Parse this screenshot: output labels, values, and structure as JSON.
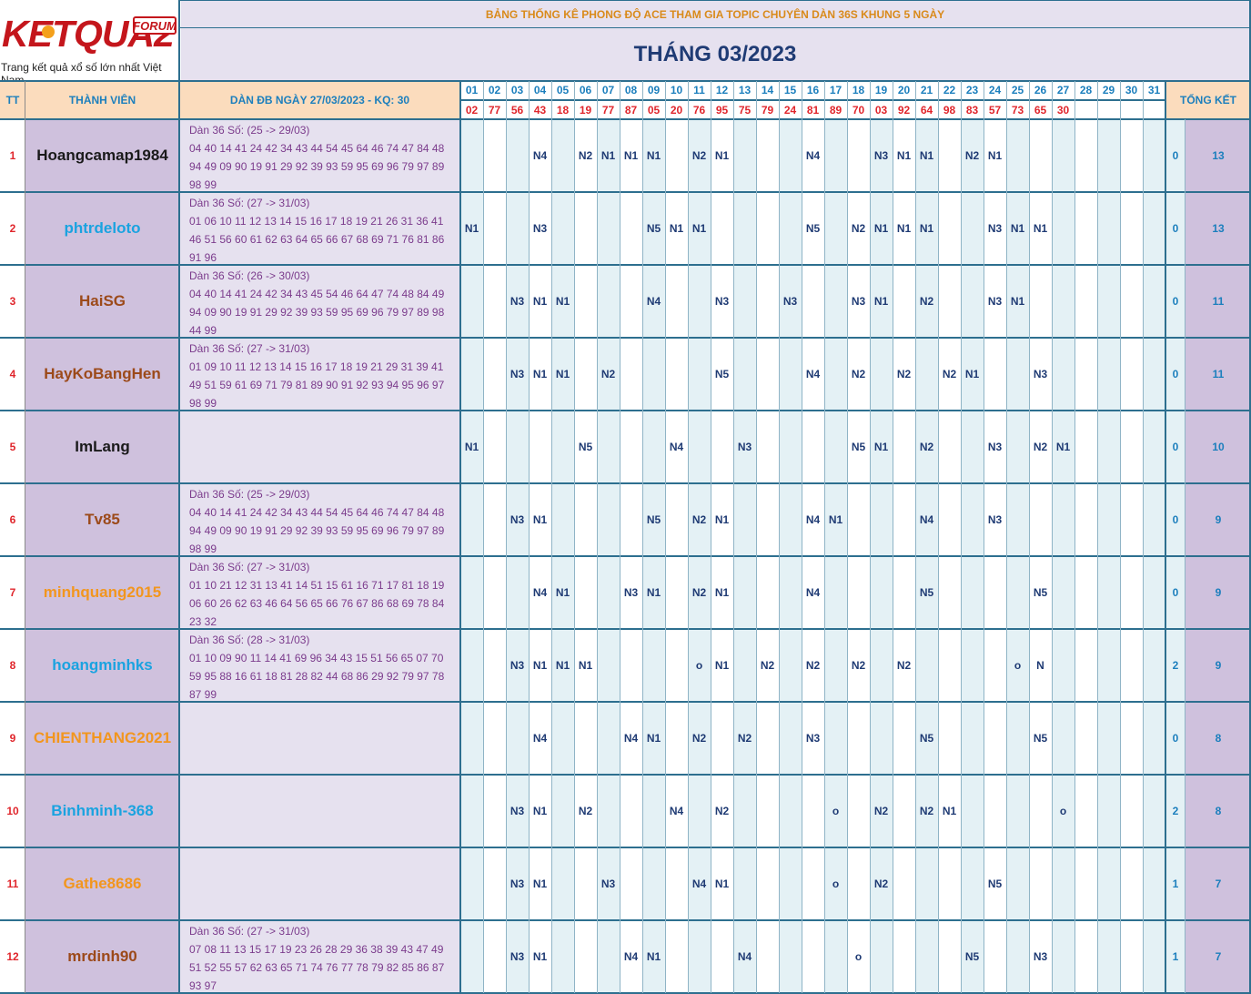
{
  "logo": {
    "word": "KETQUA2",
    "badge": "FORUM",
    "tagline": "Trang kết quả xổ số lớn nhất Việt Nam"
  },
  "header": {
    "title": "BẢNG THỐNG KÊ PHONG ĐỘ ACE THAM GIA TOPIC CHUYÊN DÀN 36S KHUNG 5 NGÀY",
    "month": "THÁNG 03/2023",
    "col_tt": "TT",
    "col_member": "THÀNH VIÊN",
    "col_dan": "DÀN ĐB NGÀY 27/03/2023 - KQ: 30",
    "col_total": "TỔNG KẾT"
  },
  "days": [
    "01",
    "02",
    "03",
    "04",
    "05",
    "06",
    "07",
    "08",
    "09",
    "10",
    "11",
    "12",
    "13",
    "14",
    "15",
    "16",
    "17",
    "18",
    "19",
    "20",
    "21",
    "22",
    "23",
    "24",
    "25",
    "26",
    "27",
    "28",
    "29",
    "30",
    "31"
  ],
  "results": [
    "02",
    "77",
    "56",
    "43",
    "18",
    "19",
    "77",
    "87",
    "05",
    "20",
    "76",
    "95",
    "75",
    "79",
    "24",
    "81",
    "89",
    "70",
    "03",
    "92",
    "64",
    "98",
    "83",
    "57",
    "73",
    "65",
    "30",
    "",
    "",
    "",
    ""
  ],
  "colors": {
    "member_bg": "#cfc1dd",
    "dan_bg": "#e6e1ef",
    "grid_a": "#e4f1f5",
    "grid_b": "#ffffff",
    "header_peach": "#fbdcbd",
    "header_lavender": "#e6e1ef",
    "border": "#2d6f8f",
    "total_b_bg": "#cfc1dd"
  },
  "rows": [
    {
      "tt": "1",
      "name": "Hoangcamap1984",
      "color": "#1a1a1a",
      "dan": [
        "Dàn 36 Số: (25 -> 29/03)",
        "04 40 14 41 24 42 34 43 44 54 45 64 46 74 47 84 48",
        "94 49 09 90 19 91 29 92 39 93 59 95 69 96 79 97 89",
        "98 99"
      ],
      "marks": {
        "4": "N4",
        "6": "N2",
        "7": "N1",
        "8": "N1",
        "9": "N1",
        "11": "N2",
        "12": "N1",
        "16": "N4",
        "19": "N3",
        "20": "N1",
        "21": "N1",
        "23": "N2",
        "24": "N1"
      },
      "total_a": "0",
      "total_b": "13"
    },
    {
      "tt": "2",
      "name": "phtrdeloto",
      "color": "#1aa3e0",
      "dan": [
        "Dàn 36 Số: (27 -> 31/03)",
        "01 06 10 11 12 13 14 15 16 17 18 19 21 26 31 36 41",
        "46 51 56 60 61 62 63 64 65 66 67 68 69 71 76 81 86",
        "91 96"
      ],
      "marks": {
        "1": "N1",
        "4": "N3",
        "9": "N5",
        "10": "N1",
        "11": "N1",
        "16": "N5",
        "18": "N2",
        "19": "N1",
        "20": "N1",
        "21": "N1",
        "24": "N3",
        "25": "N1",
        "26": "N1"
      },
      "total_a": "0",
      "total_b": "13"
    },
    {
      "tt": "3",
      "name": "HaiSG",
      "color": "#9c4a1a",
      "dan": [
        "Dàn 36 Số: (26 -> 30/03)",
        "04 40 14 41 24 42 34 43 45 54 46 64 47 74 48 84 49",
        "94 09 90 19 91 29 92 39 93 59 95 69 96 79 97 89 98",
        "44 99"
      ],
      "marks": {
        "3": "N3",
        "4": "N1",
        "5": "N1",
        "9": "N4",
        "12": "N3",
        "15": "N3",
        "18": "N3",
        "19": "N1",
        "21": "N2",
        "24": "N3",
        "25": "N1"
      },
      "total_a": "0",
      "total_b": "11"
    },
    {
      "tt": "4",
      "name": "HayKoBangHen",
      "color": "#9c4a1a",
      "dan": [
        "Dàn 36 Số: (27 -> 31/03)",
        "01 09 10 11 12 13 14 15 16 17 18 19 21 29 31 39 41",
        "49 51 59 61 69 71 79 81 89 90 91 92 93 94 95 96 97",
        "98 99"
      ],
      "marks": {
        "3": "N3",
        "4": "N1",
        "5": "N1",
        "7": "N2",
        "12": "N5",
        "16": "N4",
        "18": "N2",
        "20": "N2",
        "22": "N2",
        "23": "N1",
        "26": "N3"
      },
      "total_a": "0",
      "total_b": "11"
    },
    {
      "tt": "5",
      "name": "ImLang",
      "color": "#1a1a1a",
      "dan": [],
      "marks": {
        "1": "N1",
        "6": "N5",
        "10": "N4",
        "13": "N3",
        "18": "N5",
        "19": "N1",
        "21": "N2",
        "24": "N3",
        "26": "N2",
        "27": "N1"
      },
      "total_a": "0",
      "total_b": "10"
    },
    {
      "tt": "6",
      "name": "Tv85",
      "color": "#9c4a1a",
      "dan": [
        "Dàn 36 Số: (25 -> 29/03)",
        "04 40 14 41 24 42 34 43 44 54 45 64 46 74 47 84 48",
        "94 49 09 90 19 91 29 92 39 93 59 95 69 96 79 97 89",
        "98 99"
      ],
      "marks": {
        "3": "N3",
        "4": "N1",
        "9": "N5",
        "11": "N2",
        "12": "N1",
        "16": "N4",
        "17": "N1",
        "21": "N4",
        "24": "N3"
      },
      "total_a": "0",
      "total_b": "9"
    },
    {
      "tt": "7",
      "name": "minhquang2015",
      "color": "#f2961e",
      "dan": [
        "Dàn 36 Số: (27 -> 31/03)",
        "01 10 21 12 31 13 41 14 51 15 61 16 71 17 81 18 19",
        "06 60 26 62 63 46 64 56 65 66 76 67 86 68 69 78 84",
        "23 32"
      ],
      "marks": {
        "4": "N4",
        "5": "N1",
        "8": "N3",
        "9": "N1",
        "11": "N2",
        "12": "N1",
        "16": "N4",
        "21": "N5",
        "26": "N5"
      },
      "total_a": "0",
      "total_b": "9"
    },
    {
      "tt": "8",
      "name": "hoangminhks",
      "color": "#1aa3e0",
      "dan": [
        "Dàn 36 Số: (28 -> 31/03)",
        "01 10 09 90 11 14 41 69 96 34 43 15 51 56 65 07 70",
        "59 95 88 16 61 18 81 28 82 44 68 86 29 92 79 97 78",
        "87 99"
      ],
      "marks": {
        "3": "N3",
        "4": "N1",
        "5": "N1",
        "6": "N1",
        "11": "o",
        "12": "N1",
        "14": "N2",
        "16": "N2",
        "18": "N2",
        "20": "N2",
        "25": "o",
        "26": "N"
      },
      "total_a": "2",
      "total_b": "9"
    },
    {
      "tt": "9",
      "name": "CHIENTHANG2021",
      "color": "#f2961e",
      "dan": [],
      "marks": {
        "4": "N4",
        "8": "N4",
        "9": "N1",
        "11": "N2",
        "13": "N2",
        "16": "N3",
        "21": "N5",
        "26": "N5"
      },
      "total_a": "0",
      "total_b": "8"
    },
    {
      "tt": "10",
      "name": "Binhminh-368",
      "color": "#1aa3e0",
      "dan": [],
      "marks": {
        "3": "N3",
        "4": "N1",
        "6": "N2",
        "10": "N4",
        "12": "N2",
        "17": "o",
        "19": "N2",
        "21": "N2",
        "22": "N1",
        "27": "o"
      },
      "total_a": "2",
      "total_b": "8"
    },
    {
      "tt": "11",
      "name": "Gathe8686",
      "color": "#f2961e",
      "dan": [],
      "marks": {
        "3": "N3",
        "4": "N1",
        "7": "N3",
        "11": "N4",
        "12": "N1",
        "17": "o",
        "19": "N2",
        "24": "N5"
      },
      "total_a": "1",
      "total_b": "7"
    },
    {
      "tt": "12",
      "name": "mrdinh90",
      "color": "#9c4a1a",
      "dan": [
        "Dàn 36 Số: (27 -> 31/03)",
        "07 08 11 13 15 17 19 23 26 28 29 36 38 39 43 47 49",
        "51 52 55 57 62 63 65 71 74 76 77 78 79 82 85 86 87",
        "93 97"
      ],
      "marks": {
        "3": "N3",
        "4": "N1",
        "8": "N4",
        "9": "N1",
        "13": "N4",
        "18": "o",
        "23": "N5",
        "26": "N3"
      },
      "total_a": "1",
      "total_b": "7"
    }
  ]
}
